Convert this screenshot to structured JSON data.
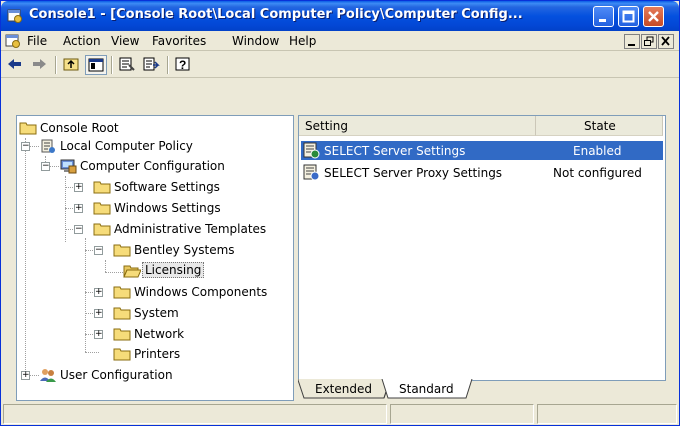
{
  "window": {
    "title": "Console1 - [Console Root\\Local Computer Policy\\Computer Config..."
  },
  "menu": {
    "file": "File",
    "action": "Action",
    "view": "View",
    "favorites": "Favorites",
    "window": "Window",
    "help": "Help"
  },
  "mdi": {
    "minimize": "_",
    "restore": "▫",
    "close": "x"
  },
  "tree": {
    "items": [
      {
        "label": "Console Root"
      },
      {
        "label": "Local Computer Policy"
      },
      {
        "label": "Computer Configuration"
      },
      {
        "label": "Software Settings"
      },
      {
        "label": "Windows Settings"
      },
      {
        "label": "Administrative Templates"
      },
      {
        "label": "Bentley Systems"
      },
      {
        "label": "Licensing"
      },
      {
        "label": "Windows Components"
      },
      {
        "label": "System"
      },
      {
        "label": "Network"
      },
      {
        "label": "Printers"
      },
      {
        "label": "User Configuration"
      }
    ]
  },
  "list": {
    "columns": {
      "setting": "Setting",
      "state": "State"
    },
    "rows": [
      {
        "setting": "SELECT Server Settings",
        "state": "Enabled"
      },
      {
        "setting": "SELECT Server Proxy Settings",
        "state": "Not configured"
      }
    ]
  },
  "tabs": {
    "extended": "Extended",
    "standard": "Standard"
  },
  "colors": {
    "selection": "#316ac5",
    "titlebar": "#0451df"
  }
}
